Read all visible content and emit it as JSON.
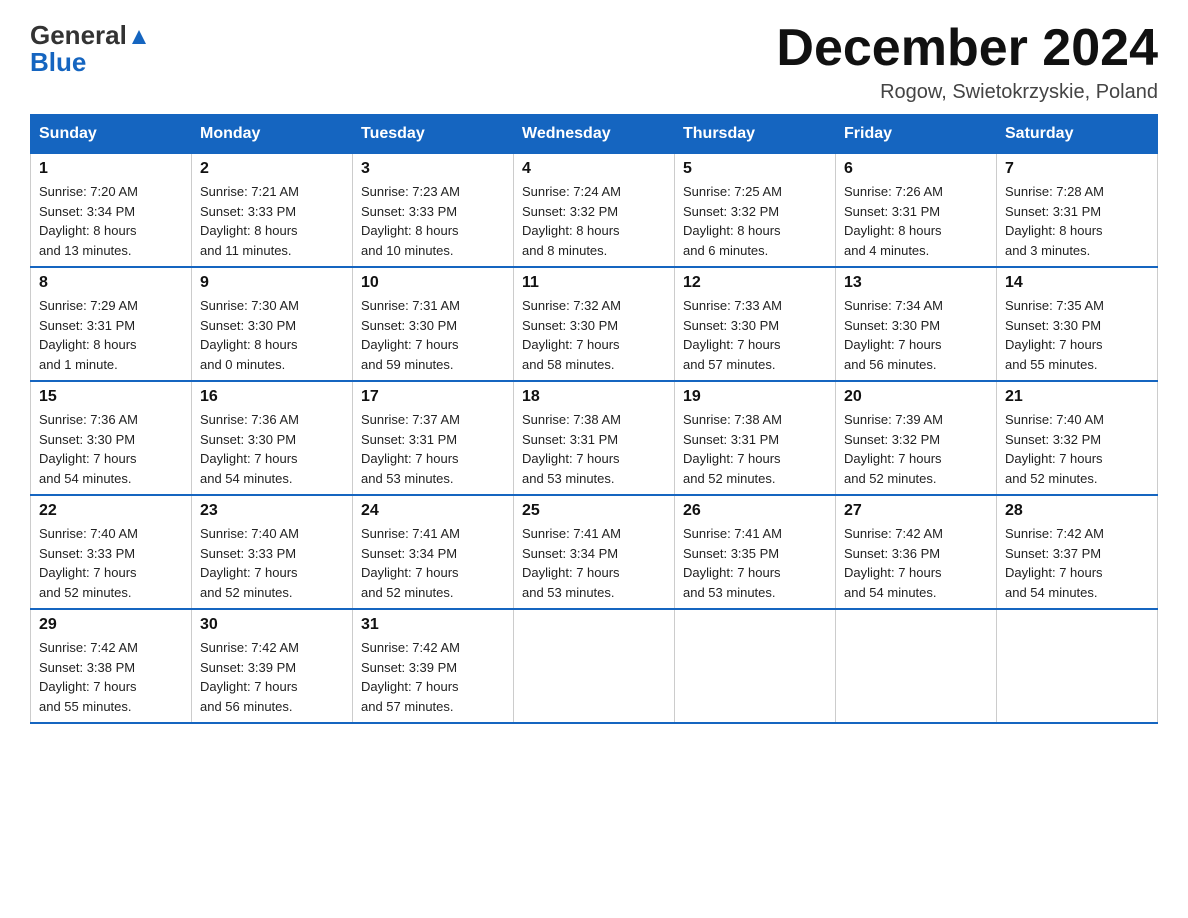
{
  "header": {
    "logo_general": "General",
    "logo_blue": "Blue",
    "month_title": "December 2024",
    "location": "Rogow, Swietokrzyskie, Poland"
  },
  "days_of_week": [
    "Sunday",
    "Monday",
    "Tuesday",
    "Wednesday",
    "Thursday",
    "Friday",
    "Saturday"
  ],
  "weeks": [
    [
      {
        "day": "1",
        "sunrise": "7:20 AM",
        "sunset": "3:34 PM",
        "daylight": "8 hours and 13 minutes."
      },
      {
        "day": "2",
        "sunrise": "7:21 AM",
        "sunset": "3:33 PM",
        "daylight": "8 hours and 11 minutes."
      },
      {
        "day": "3",
        "sunrise": "7:23 AM",
        "sunset": "3:33 PM",
        "daylight": "8 hours and 10 minutes."
      },
      {
        "day": "4",
        "sunrise": "7:24 AM",
        "sunset": "3:32 PM",
        "daylight": "8 hours and 8 minutes."
      },
      {
        "day": "5",
        "sunrise": "7:25 AM",
        "sunset": "3:32 PM",
        "daylight": "8 hours and 6 minutes."
      },
      {
        "day": "6",
        "sunrise": "7:26 AM",
        "sunset": "3:31 PM",
        "daylight": "8 hours and 4 minutes."
      },
      {
        "day": "7",
        "sunrise": "7:28 AM",
        "sunset": "3:31 PM",
        "daylight": "8 hours and 3 minutes."
      }
    ],
    [
      {
        "day": "8",
        "sunrise": "7:29 AM",
        "sunset": "3:31 PM",
        "daylight": "8 hours and 1 minute."
      },
      {
        "day": "9",
        "sunrise": "7:30 AM",
        "sunset": "3:30 PM",
        "daylight": "8 hours and 0 minutes."
      },
      {
        "day": "10",
        "sunrise": "7:31 AM",
        "sunset": "3:30 PM",
        "daylight": "7 hours and 59 minutes."
      },
      {
        "day": "11",
        "sunrise": "7:32 AM",
        "sunset": "3:30 PM",
        "daylight": "7 hours and 58 minutes."
      },
      {
        "day": "12",
        "sunrise": "7:33 AM",
        "sunset": "3:30 PM",
        "daylight": "7 hours and 57 minutes."
      },
      {
        "day": "13",
        "sunrise": "7:34 AM",
        "sunset": "3:30 PM",
        "daylight": "7 hours and 56 minutes."
      },
      {
        "day": "14",
        "sunrise": "7:35 AM",
        "sunset": "3:30 PM",
        "daylight": "7 hours and 55 minutes."
      }
    ],
    [
      {
        "day": "15",
        "sunrise": "7:36 AM",
        "sunset": "3:30 PM",
        "daylight": "7 hours and 54 minutes."
      },
      {
        "day": "16",
        "sunrise": "7:36 AM",
        "sunset": "3:30 PM",
        "daylight": "7 hours and 54 minutes."
      },
      {
        "day": "17",
        "sunrise": "7:37 AM",
        "sunset": "3:31 PM",
        "daylight": "7 hours and 53 minutes."
      },
      {
        "day": "18",
        "sunrise": "7:38 AM",
        "sunset": "3:31 PM",
        "daylight": "7 hours and 53 minutes."
      },
      {
        "day": "19",
        "sunrise": "7:38 AM",
        "sunset": "3:31 PM",
        "daylight": "7 hours and 52 minutes."
      },
      {
        "day": "20",
        "sunrise": "7:39 AM",
        "sunset": "3:32 PM",
        "daylight": "7 hours and 52 minutes."
      },
      {
        "day": "21",
        "sunrise": "7:40 AM",
        "sunset": "3:32 PM",
        "daylight": "7 hours and 52 minutes."
      }
    ],
    [
      {
        "day": "22",
        "sunrise": "7:40 AM",
        "sunset": "3:33 PM",
        "daylight": "7 hours and 52 minutes."
      },
      {
        "day": "23",
        "sunrise": "7:40 AM",
        "sunset": "3:33 PM",
        "daylight": "7 hours and 52 minutes."
      },
      {
        "day": "24",
        "sunrise": "7:41 AM",
        "sunset": "3:34 PM",
        "daylight": "7 hours and 52 minutes."
      },
      {
        "day": "25",
        "sunrise": "7:41 AM",
        "sunset": "3:34 PM",
        "daylight": "7 hours and 53 minutes."
      },
      {
        "day": "26",
        "sunrise": "7:41 AM",
        "sunset": "3:35 PM",
        "daylight": "7 hours and 53 minutes."
      },
      {
        "day": "27",
        "sunrise": "7:42 AM",
        "sunset": "3:36 PM",
        "daylight": "7 hours and 54 minutes."
      },
      {
        "day": "28",
        "sunrise": "7:42 AM",
        "sunset": "3:37 PM",
        "daylight": "7 hours and 54 minutes."
      }
    ],
    [
      {
        "day": "29",
        "sunrise": "7:42 AM",
        "sunset": "3:38 PM",
        "daylight": "7 hours and 55 minutes."
      },
      {
        "day": "30",
        "sunrise": "7:42 AM",
        "sunset": "3:39 PM",
        "daylight": "7 hours and 56 minutes."
      },
      {
        "day": "31",
        "sunrise": "7:42 AM",
        "sunset": "3:39 PM",
        "daylight": "7 hours and 57 minutes."
      },
      null,
      null,
      null,
      null
    ]
  ],
  "labels": {
    "sunrise": "Sunrise:",
    "sunset": "Sunset:",
    "daylight": "Daylight:"
  }
}
